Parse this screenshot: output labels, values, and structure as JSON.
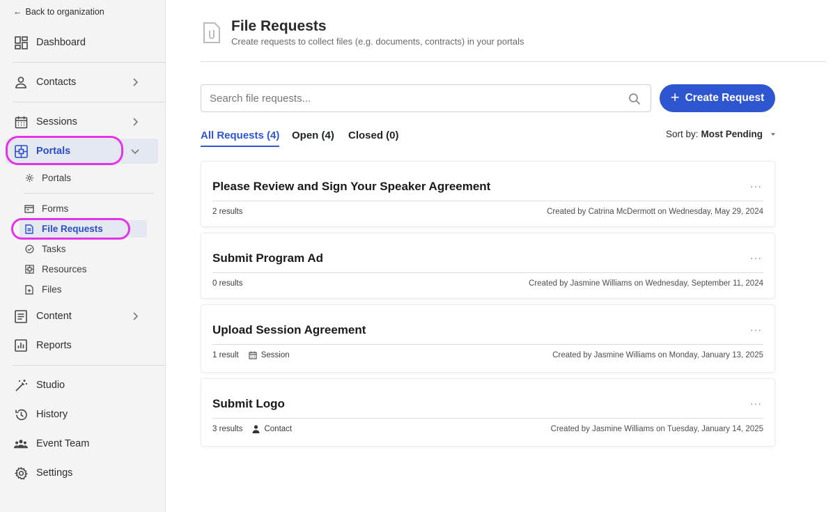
{
  "sidebar": {
    "back_label": "Back to organization",
    "items": {
      "dashboard": "Dashboard",
      "contacts": "Contacts",
      "sessions": "Sessions",
      "portals": "Portals",
      "content": "Content",
      "reports": "Reports",
      "studio": "Studio",
      "history": "History",
      "event_team": "Event Team",
      "settings": "Settings"
    },
    "portal_sub": {
      "portals": "Portals",
      "forms": "Forms",
      "file_requests": "File Requests",
      "tasks": "Tasks",
      "resources": "Resources",
      "files": "Files"
    },
    "active_color": "#2b4cc8",
    "highlight_color": "#e233e8"
  },
  "header": {
    "title": "File Requests",
    "subtitle": "Create requests to collect files (e.g. documents, contracts) in your portals"
  },
  "search": {
    "placeholder": "Search file requests..."
  },
  "create_button": "Create Request",
  "tabs": {
    "all": "All Requests (4)",
    "open": "Open (4)",
    "closed": "Closed (0)"
  },
  "sort": {
    "label": "Sort by:",
    "value": "Most Pending"
  },
  "requests": [
    {
      "title": "Please Review and Sign Your Speaker Agreement",
      "results": "2 results",
      "tag": "",
      "created": "Created by Catrina McDermott on Wednesday, May 29, 2024"
    },
    {
      "title": "Submit Program Ad",
      "results": "0 results",
      "tag": "",
      "created": "Created by Jasmine Williams on Wednesday, September 11, 2024"
    },
    {
      "title": "Upload Session Agreement",
      "results": "1 result",
      "tag": "Session",
      "created": "Created by Jasmine Williams on Monday, January 13, 2025"
    },
    {
      "title": "Submit Logo",
      "results": "3 results",
      "tag": "Contact",
      "created": "Created by Jasmine Williams on Tuesday, January 14, 2025"
    }
  ],
  "more_label": "···",
  "primary_color": "#2e56d1"
}
